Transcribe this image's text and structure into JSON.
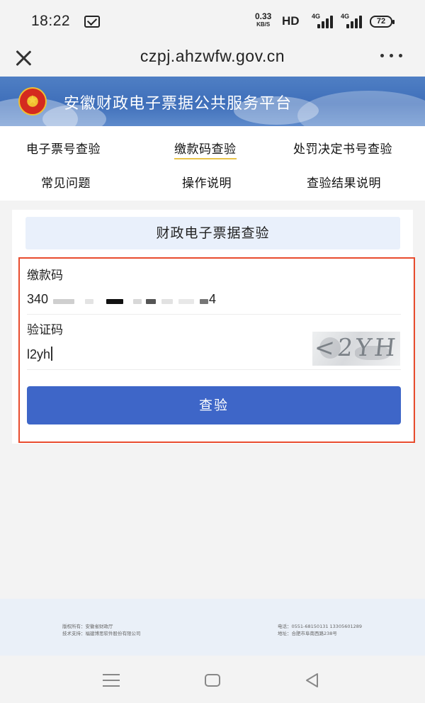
{
  "status_bar": {
    "time": "18:22",
    "net_speed_value": "0.33",
    "net_speed_unit": "KB/S",
    "hd_label": "HD",
    "signal1_label": "4G",
    "signal2_label": "4G",
    "battery": "72"
  },
  "browser": {
    "url": "czpj.ahzwfw.gov.cn"
  },
  "banner": {
    "title": "安徽财政电子票据公共服务平台"
  },
  "nav": {
    "items": [
      {
        "label": "电子票号查验"
      },
      {
        "label": "缴款码查验"
      },
      {
        "label": "处罚决定书号查验"
      },
      {
        "label": "常见问题"
      },
      {
        "label": "操作说明"
      },
      {
        "label": "查验结果说明"
      }
    ]
  },
  "form": {
    "header": "财政电子票据查验",
    "payment_code_label": "缴款码",
    "payment_code_prefix": "340",
    "payment_code_suffix": "4",
    "captcha_label": "验证码",
    "captcha_value": "l2yh",
    "captcha_image_text": "<2YH",
    "submit_label": "查验"
  },
  "footer": {
    "copyright": "版权所有：安徽省财政厅",
    "tech_support": "技术支持：福建博思软件股份有限公司",
    "phone": "电话：0551-68150131 13305601289",
    "address": "地址：合肥市阜南西路238号"
  },
  "colors": {
    "accent_blue": "#3e66c8",
    "highlight_border": "#e84c2e",
    "banner_blue": "#4675c0",
    "active_underline": "#e8c24a"
  }
}
